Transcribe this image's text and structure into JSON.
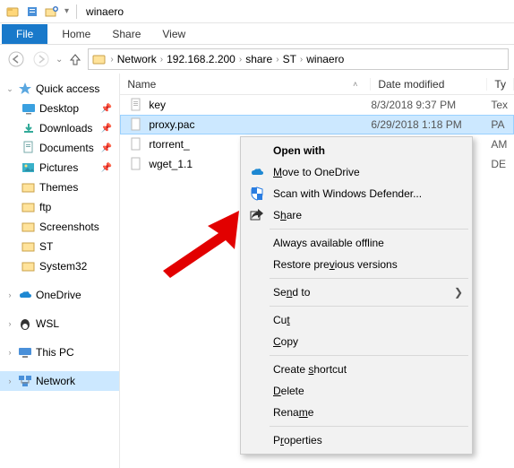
{
  "window": {
    "title": "winaero"
  },
  "ribbon": {
    "file": "File",
    "home": "Home",
    "share": "Share",
    "view": "View"
  },
  "breadcrumb": [
    "Network",
    "192.168.2.200",
    "share",
    "ST",
    "winaero"
  ],
  "columns": {
    "name": "Name",
    "date": "Date modified",
    "type": "Ty"
  },
  "nav": {
    "quick_access": "Quick access",
    "items": [
      {
        "label": "Desktop"
      },
      {
        "label": "Downloads"
      },
      {
        "label": "Documents"
      },
      {
        "label": "Pictures"
      },
      {
        "label": "Themes"
      },
      {
        "label": "ftp"
      },
      {
        "label": "Screenshots"
      },
      {
        "label": "ST"
      },
      {
        "label": "System32"
      }
    ],
    "onedrive": "OneDrive",
    "wsl": "WSL",
    "thispc": "This PC",
    "network": "Network"
  },
  "files": [
    {
      "name": "key",
      "date": "8/3/2018 9:37 PM",
      "type": "Tex"
    },
    {
      "name": "proxy.pac",
      "date": "6/29/2018 1:18 PM",
      "type": "PA"
    },
    {
      "name": "rtorrent_",
      "date": "",
      "type": "AM"
    },
    {
      "name": "wget_1.1",
      "date": "",
      "type": "DE"
    }
  ],
  "context_menu": {
    "open_with": "Open with",
    "onedrive": "Move to OneDrive",
    "defender": "Scan with Windows Defender...",
    "share": "Share",
    "offline": "Always available offline",
    "restore": "Restore previous versions",
    "send_to": "Send to",
    "cut": "Cut",
    "copy": "Copy",
    "shortcut": "Create shortcut",
    "delete": "Delete",
    "rename": "Rename",
    "properties": "Properties"
  }
}
